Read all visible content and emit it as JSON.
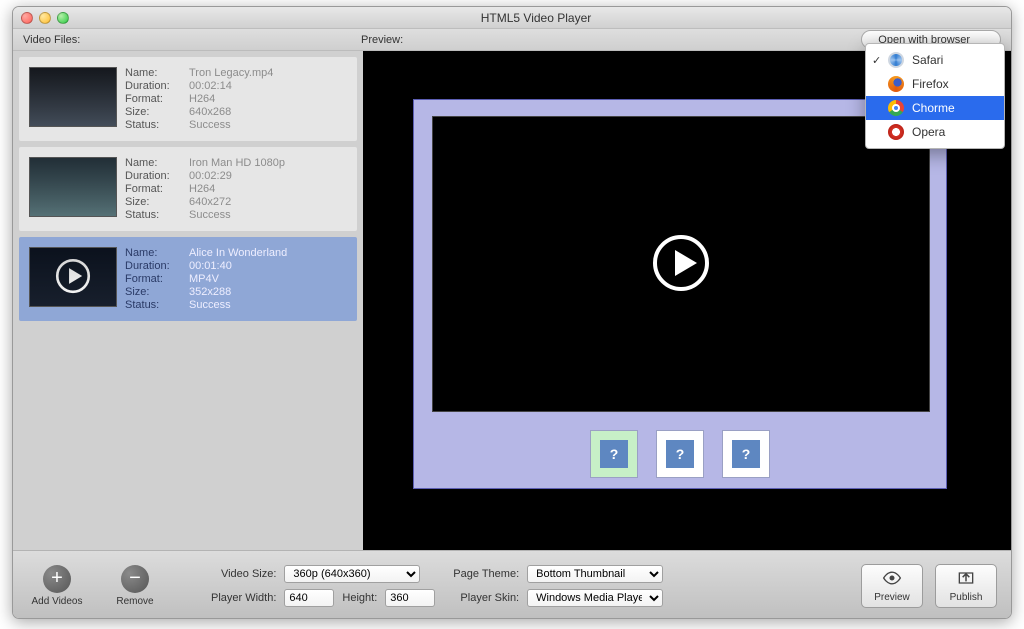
{
  "window": {
    "title": "HTML5 Video Player"
  },
  "header": {
    "video_files_label": "Video Files:",
    "preview_label": "Preview:",
    "open_with_browser_label": "Open with browser"
  },
  "files": [
    {
      "name": "Tron Legacy.mp4",
      "duration": "00:02:14",
      "format": "H264",
      "size": "640x268",
      "status": "Success",
      "selected": false,
      "play_overlay": false
    },
    {
      "name": "Iron Man HD 1080p",
      "duration": "00:02:29",
      "format": "H264",
      "size": "640x272",
      "status": "Success",
      "selected": false,
      "play_overlay": false
    },
    {
      "name": "Alice In Wonderland",
      "duration": "00:01:40",
      "format": "MP4V",
      "size": "352x288",
      "status": "Success",
      "selected": true,
      "play_overlay": true
    }
  ],
  "meta_labels": {
    "name": "Name:",
    "duration": "Duration:",
    "format": "Format:",
    "size": "Size:",
    "status": "Status:"
  },
  "browser_menu": {
    "items": [
      {
        "label": "Safari",
        "checked": true,
        "selected": false,
        "icon": "safari"
      },
      {
        "label": "Firefox",
        "checked": false,
        "selected": false,
        "icon": "firefox"
      },
      {
        "label": "Chorme",
        "checked": false,
        "selected": true,
        "icon": "chrome"
      },
      {
        "label": "Opera",
        "checked": false,
        "selected": false,
        "icon": "opera"
      }
    ]
  },
  "footer": {
    "add_videos_label": "Add Videos",
    "remove_label": "Remove",
    "video_size_label": "Video Size:",
    "video_size_value": "360p (640x360)",
    "player_width_label": "Player Width:",
    "player_width_value": "640",
    "height_label": "Height:",
    "height_value": "360",
    "page_theme_label": "Page Theme:",
    "page_theme_value": "Bottom Thumbnail",
    "player_skin_label": "Player Skin:",
    "player_skin_value": "Windows Media Player",
    "preview_label": "Preview",
    "publish_label": "Publish"
  },
  "thumbstrip": {
    "glyph": "?"
  }
}
